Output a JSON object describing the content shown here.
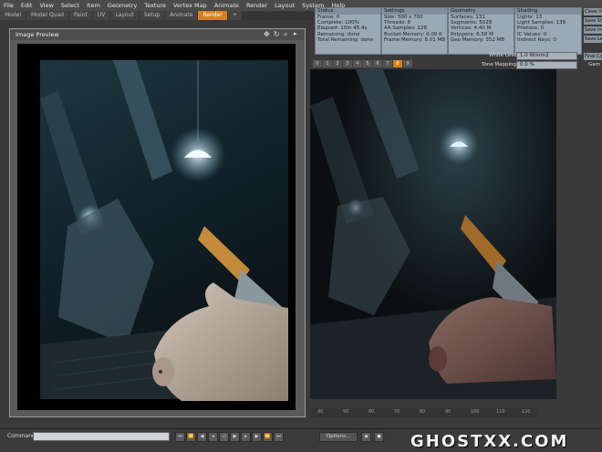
{
  "menubar": {
    "items": [
      "File",
      "Edit",
      "View",
      "Select",
      "Item",
      "Geometry",
      "Texture",
      "Vertex Map",
      "Animate",
      "Render",
      "Layout",
      "System",
      "Help"
    ]
  },
  "tabs": {
    "items": [
      "Model",
      "Model Quad",
      "Paint",
      "UV",
      "Layout",
      "Setup",
      "Animate",
      "Render",
      "+"
    ],
    "active": "Render"
  },
  "panels": {
    "status": {
      "title": "Status",
      "lines": [
        "Frame: 0",
        "Complete: 100%",
        "Elapsed: 10m 45.4s",
        "Remaining: done",
        "Total Remaining: done"
      ]
    },
    "settings": {
      "title": "Settings",
      "lines": [
        "Size: 500 x 700",
        "Threads: 8",
        "AA Samples: 128",
        "Bucket Memory: 0.00 K",
        "Frame Memory: 8.01 MB"
      ]
    },
    "geometry": {
      "title": "Geometry",
      "lines": [
        "Surfaces: 131",
        "Segments: 5028",
        "Vertices: 4.40 M",
        "Polygons: 6.58 M",
        "Geo Memory: 352 MB"
      ]
    },
    "shading": {
      "title": "Shading",
      "lines": [
        "Lights: 13",
        "Light Samples: 139",
        "Photons: 0",
        "IC Values: 0",
        "Indirect Rays: 0"
      ]
    }
  },
  "buffers": {
    "items": [
      "0",
      "1",
      "2",
      "3",
      "4",
      "5",
      "6",
      "7",
      "8",
      "9"
    ],
    "active": "8"
  },
  "controls": {
    "white_level_label": "White Level",
    "white_level_value": "1.0 W/srm2",
    "tone_mapping_label": "Tone Mapping",
    "tone_mapping_value": "0.0 %"
  },
  "right_buttons": [
    "Close V",
    "Save St",
    "Save Im",
    "Save Lay",
    "Final Co",
    "Gam"
  ],
  "preview": {
    "title": "Image Preview"
  },
  "bottom": {
    "command_label": "Command",
    "options_label": "Options...",
    "ruler_ticks": [
      "40",
      "50",
      "60",
      "70",
      "80",
      "90",
      "100",
      "110",
      "120"
    ]
  },
  "watermark": "GHOSTXX.COM",
  "colors": {
    "accent": "#d8801a",
    "panel": "#9aa9b3",
    "scene_dark": "#0d1214",
    "lamp": "#cfe6f2"
  }
}
